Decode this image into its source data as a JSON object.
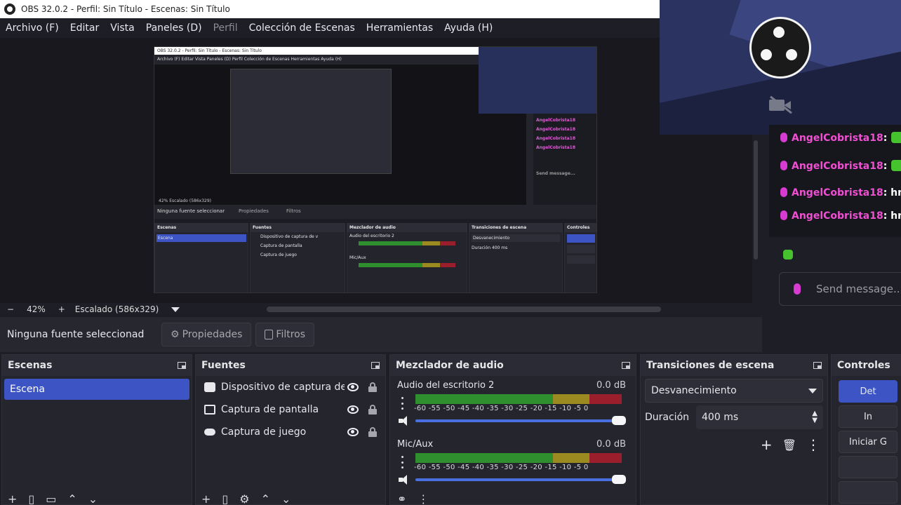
{
  "window": {
    "title": "OBS 32.0.2 - Perfil: Sin Título - Escenas: Sin Título"
  },
  "menu": [
    {
      "label": "Archivo (F)",
      "disabled": false
    },
    {
      "label": "Editar",
      "disabled": false
    },
    {
      "label": "Vista",
      "disabled": false
    },
    {
      "label": "Paneles (D)",
      "disabled": false
    },
    {
      "label": "Perfil",
      "disabled": true
    },
    {
      "label": "Colección de Escenas",
      "disabled": false
    },
    {
      "label": "Herramientas",
      "disabled": false
    },
    {
      "label": "Ayuda (H)",
      "disabled": false
    }
  ],
  "zoom": {
    "minus": "−",
    "value": "42%",
    "plus": "+",
    "scale": "Escalado (586x329)"
  },
  "properties_bar": {
    "no_source": "Ninguna fuente seleccionad",
    "properties": "Propiedades",
    "filters": "Filtros"
  },
  "scenes": {
    "title": "Escenas",
    "items": [
      "Escena"
    ]
  },
  "sources": {
    "title": "Fuentes",
    "items": [
      {
        "icon": "camera-icon",
        "label": "Dispositivo de captura de v"
      },
      {
        "icon": "monitor-icon",
        "label": "Captura de pantalla"
      },
      {
        "icon": "gamepad-icon",
        "label": "Captura de juego"
      }
    ]
  },
  "mixer": {
    "title": "Mezclador de audio",
    "ticks": "-60  -55  -50  -45  -40  -35  -30  -25  -20  -15  -10  -5   0",
    "channels": [
      {
        "name": "Audio del escritorio 2",
        "db": "0.0 dB",
        "volume": 1.0
      },
      {
        "name": "Mic/Aux",
        "db": "0.0 dB",
        "volume": 1.0
      }
    ]
  },
  "transitions": {
    "title": "Transiciones de escena",
    "selected": "Desvanecimiento",
    "duration_label": "Duración",
    "duration_value": "400 ms"
  },
  "controls": {
    "title": "Controles",
    "buttons": [
      "Det",
      "In",
      "Iniciar G",
      "",
      ""
    ]
  },
  "chat": {
    "messages": [
      {
        "user": "AngelCobrista18",
        "text": ":",
        "emote": true
      },
      {
        "user": "AngelCobrista18",
        "text": ":",
        "emote": true
      },
      {
        "user": "AngelCobrista18",
        "text": ": hnj",
        "emote": false
      },
      {
        "user": "AngelCobrista18",
        "text": ": hnj",
        "emote": false
      }
    ],
    "send_placeholder": "Send message..."
  },
  "nested_preview": {
    "title": "OBS 32.0.2 - Perfil: Sin Título - Escenas: Sin Título",
    "menu": "Archivo (F)   Editar   Vista   Paneles (D)   Perfil   Colección de Escenas   Herramientas   Ayuda (H)",
    "zoom": "42%     Escalado (586x329)",
    "no_source": "Ninguna fuente seleccionar",
    "properties": "Propiedades",
    "filters": "Filtros",
    "panels": [
      "Escenas",
      "Fuentes",
      "Mezclador de audio",
      "Transiciones de escena",
      "Controles"
    ],
    "scene": "Escena",
    "sources": [
      "Dispositivo de captura de v",
      "Captura de pantalla",
      "Captura de juego"
    ],
    "channels": [
      "Audio del escritorio 2",
      "Mic/Aux"
    ],
    "transition": "Desvanecimiento",
    "duration": "Duración   400 ms",
    "chat_user": "AngelCobrista18",
    "send": "Send message..."
  }
}
